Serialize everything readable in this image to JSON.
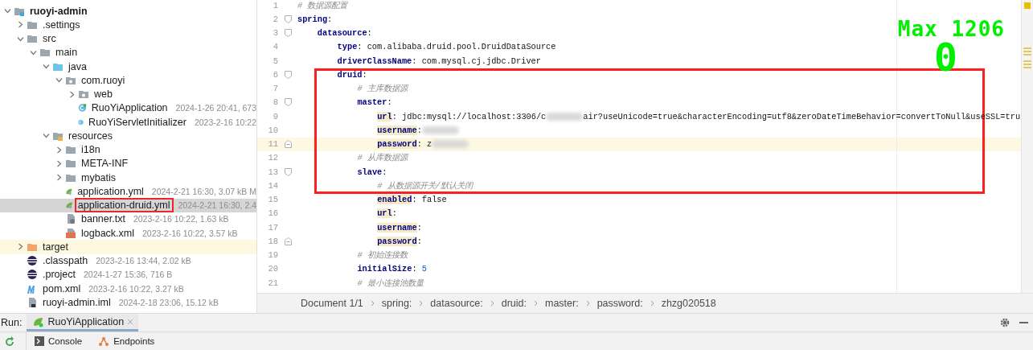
{
  "project_tree": {
    "items": [
      {
        "label": "ruoyi-admin",
        "kind": "module",
        "expanded": true,
        "selected": false,
        "boxed": false,
        "children": [
          {
            "label": ".settings",
            "kind": "folder",
            "expanded": false,
            "selected": false,
            "boxed": false
          },
          {
            "label": "src",
            "kind": "folder",
            "expanded": true,
            "selected": false,
            "boxed": false,
            "children": [
              {
                "label": "main",
                "kind": "folder",
                "expanded": true,
                "selected": false,
                "boxed": false,
                "children": [
                  {
                    "label": "java",
                    "kind": "source-folder",
                    "expanded": true,
                    "selected": false,
                    "boxed": false,
                    "children": [
                      {
                        "label": "com.ruoyi",
                        "kind": "package",
                        "expanded": true,
                        "selected": false,
                        "boxed": false,
                        "children": [
                          {
                            "label": "web",
                            "kind": "package",
                            "expanded": false,
                            "selected": false,
                            "boxed": false
                          },
                          {
                            "label": "RuoYiApplication",
                            "meta": "2024-1-26 20:41, 673",
                            "kind": "spring-class",
                            "selected": false,
                            "boxed": false
                          },
                          {
                            "label": "RuoYiServletInitializer",
                            "meta": "2023-2-16 10:22",
                            "kind": "class",
                            "selected": false,
                            "boxed": false
                          }
                        ]
                      }
                    ]
                  },
                  {
                    "label": "resources",
                    "kind": "resources-folder",
                    "expanded": true,
                    "selected": false,
                    "boxed": false,
                    "children": [
                      {
                        "label": "i18n",
                        "kind": "folder",
                        "expanded": false,
                        "selected": false,
                        "boxed": false
                      },
                      {
                        "label": "META-INF",
                        "kind": "folder",
                        "expanded": false,
                        "selected": false,
                        "boxed": false
                      },
                      {
                        "label": "mybatis",
                        "kind": "folder",
                        "expanded": false,
                        "selected": false,
                        "boxed": false
                      },
                      {
                        "label": "application.yml",
                        "meta": "2024-2-21 16:30, 3.07 kB M",
                        "kind": "yml",
                        "selected": false,
                        "boxed": false
                      },
                      {
                        "label": "application-druid.yml",
                        "meta": "2024-2-21 16:30, 2.4",
                        "kind": "yml",
                        "selected": true,
                        "boxed": true
                      },
                      {
                        "label": "banner.txt",
                        "meta": "2023-2-16 10:22, 1.63 kB",
                        "kind": "txt",
                        "selected": false,
                        "boxed": false
                      },
                      {
                        "label": "logback.xml",
                        "meta": "2023-2-16 10:22, 3.57 kB",
                        "kind": "xml",
                        "selected": false,
                        "boxed": false
                      }
                    ]
                  }
                ]
              }
            ]
          },
          {
            "label": "target",
            "kind": "excluded-folder",
            "expanded": false,
            "selected": false,
            "boxed": false
          },
          {
            "label": ".classpath",
            "meta": "2023-2-16 13:44, 2.02 kB",
            "kind": "eclipse",
            "selected": false,
            "boxed": false
          },
          {
            "label": ".project",
            "meta": "2024-1-27 15:36, 716 B",
            "kind": "eclipse",
            "selected": false,
            "boxed": false
          },
          {
            "label": "pom.xml",
            "meta": "2023-2-16 10:22, 3.27 kB",
            "kind": "maven",
            "selected": false,
            "boxed": false
          },
          {
            "label": "ruoyi-admin.iml",
            "meta": "2024-2-18 23:06, 15.12 kB",
            "kind": "iml",
            "selected": false,
            "boxed": false
          }
        ]
      }
    ]
  },
  "editor": {
    "overlay": {
      "max_label": "Max 1206",
      "counter": "0"
    },
    "lines": [
      {
        "number": "1",
        "kind": "plain",
        "current": false,
        "boxed": false,
        "tokens": [
          {
            "kind": "comment",
            "text": "# 数据源配置"
          }
        ]
      },
      {
        "number": "2",
        "kind": "fold-start",
        "current": false,
        "boxed": false,
        "tokens": [
          {
            "kind": "key",
            "text": "spring"
          },
          {
            "kind": "plain",
            "text": ":"
          }
        ],
        "children": [
          {
            "number": "3",
            "kind": "fold-start",
            "current": false,
            "boxed": false,
            "tokens": [
              {
                "kind": "key",
                "text": "datasource"
              },
              {
                "kind": "plain",
                "text": ":"
              }
            ],
            "children": [
              {
                "number": "4",
                "kind": "plain",
                "current": false,
                "boxed": false,
                "tokens": [
                  {
                    "kind": "key",
                    "text": "type"
                  },
                  {
                    "kind": "plain",
                    "text": ": com.alibaba.druid.pool.DruidDataSource"
                  }
                ]
              },
              {
                "number": "5",
                "kind": "plain",
                "current": false,
                "boxed": false,
                "tokens": [
                  {
                    "kind": "key",
                    "text": "driverClassName"
                  },
                  {
                    "kind": "plain",
                    "text": ": com.mysql.cj.jdbc.Driver"
                  }
                ]
              },
              {
                "number": "6",
                "kind": "fold-start",
                "current": false,
                "boxed": true,
                "tokens": [
                  {
                    "kind": "key",
                    "text": "druid"
                  },
                  {
                    "kind": "plain",
                    "text": ":"
                  }
                ],
                "children": [
                  {
                    "number": "7",
                    "kind": "plain",
                    "current": false,
                    "boxed": true,
                    "tokens": [
                      {
                        "kind": "comment",
                        "text": "# 主库数据源"
                      }
                    ]
                  },
                  {
                    "number": "8",
                    "kind": "fold-start",
                    "current": false,
                    "boxed": true,
                    "tokens": [
                      {
                        "kind": "key",
                        "text": "master"
                      },
                      {
                        "kind": "plain",
                        "text": ":"
                      }
                    ],
                    "children": [
                      {
                        "number": "9",
                        "kind": "plain",
                        "current": false,
                        "boxed": true,
                        "tokens": [
                          {
                            "kind": "key-marked",
                            "text": "url"
                          },
                          {
                            "kind": "plain",
                            "text": ": jdbc:mysql://localhost:3306/c"
                          },
                          {
                            "kind": "redacted"
                          },
                          {
                            "kind": "plain",
                            "text": "air?useUnicode=true&characterEncoding=utf8&zeroDateTimeBehavior=convertToNull&useSSL=tru"
                          }
                        ]
                      },
                      {
                        "number": "10",
                        "kind": "plain",
                        "current": false,
                        "boxed": true,
                        "tokens": [
                          {
                            "kind": "key-marked",
                            "text": "username"
                          },
                          {
                            "kind": "plain",
                            "text": ":"
                          },
                          {
                            "kind": "redacted"
                          }
                        ]
                      },
                      {
                        "number": "11",
                        "kind": "fold-end",
                        "current": true,
                        "boxed": true,
                        "tokens": [
                          {
                            "kind": "key-marked",
                            "text": "password"
                          },
                          {
                            "kind": "plain",
                            "text": ": z"
                          },
                          {
                            "kind": "redacted"
                          }
                        ]
                      }
                    ]
                  },
                  {
                    "number": "12",
                    "kind": "plain",
                    "current": false,
                    "boxed": true,
                    "tokens": [
                      {
                        "kind": "comment",
                        "text": "# 从库数据源"
                      }
                    ]
                  },
                  {
                    "number": "13",
                    "kind": "fold-start",
                    "current": false,
                    "boxed": true,
                    "tokens": [
                      {
                        "kind": "key",
                        "text": "slave"
                      },
                      {
                        "kind": "plain",
                        "text": ":"
                      }
                    ],
                    "children": [
                      {
                        "number": "14",
                        "kind": "plain",
                        "current": false,
                        "boxed": true,
                        "tokens": [
                          {
                            "kind": "comment",
                            "text": "# 从数据源开关/默认关闭"
                          }
                        ]
                      },
                      {
                        "number": "15",
                        "kind": "plain",
                        "current": false,
                        "boxed": false,
                        "tokens": [
                          {
                            "kind": "key-marked",
                            "text": "enabled"
                          },
                          {
                            "kind": "plain",
                            "text": ": false"
                          }
                        ]
                      },
                      {
                        "number": "16",
                        "kind": "plain",
                        "current": false,
                        "boxed": false,
                        "tokens": [
                          {
                            "kind": "key-marked",
                            "text": "url"
                          },
                          {
                            "kind": "plain",
                            "text": ":"
                          }
                        ]
                      },
                      {
                        "number": "17",
                        "kind": "plain",
                        "current": false,
                        "boxed": false,
                        "tokens": [
                          {
                            "kind": "key-marked",
                            "text": "username"
                          },
                          {
                            "kind": "plain",
                            "text": ":"
                          }
                        ]
                      },
                      {
                        "number": "18",
                        "kind": "fold-end",
                        "current": false,
                        "boxed": false,
                        "tokens": [
                          {
                            "kind": "key-marked",
                            "text": "password"
                          },
                          {
                            "kind": "plain",
                            "text": ":"
                          }
                        ]
                      }
                    ]
                  },
                  {
                    "number": "19",
                    "kind": "plain",
                    "current": false,
                    "boxed": false,
                    "tokens": [
                      {
                        "kind": "comment",
                        "text": "# 初始连接数"
                      }
                    ]
                  },
                  {
                    "number": "20",
                    "kind": "plain",
                    "current": false,
                    "boxed": false,
                    "tokens": [
                      {
                        "kind": "key",
                        "text": "initialSize"
                      },
                      {
                        "kind": "plain",
                        "text": ": "
                      },
                      {
                        "kind": "number",
                        "text": "5"
                      }
                    ]
                  },
                  {
                    "number": "21",
                    "kind": "plain",
                    "current": false,
                    "boxed": false,
                    "tokens": [
                      {
                        "kind": "comment",
                        "text": "# 最小连接池数量"
                      }
                    ]
                  }
                ]
              }
            ]
          }
        ]
      }
    ]
  },
  "breadcrumb": [
    "Document 1/1",
    "spring:",
    "datasource:",
    "druid:",
    "master:",
    "password:",
    "zhzg020518"
  ],
  "run_bar": {
    "label": "Run:",
    "tabs": [
      {
        "label": "RuoYiApplication",
        "selected": true
      }
    ]
  },
  "run_toolbar": {
    "tabs": [
      {
        "label": "Console",
        "kind": "console"
      },
      {
        "label": "Endpoints",
        "kind": "endpoints"
      }
    ]
  }
}
